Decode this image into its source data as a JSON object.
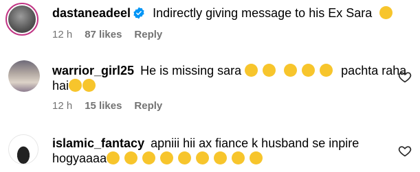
{
  "comments": [
    {
      "username": "dastaneadeel",
      "verified": true,
      "text": "Indirectly giving message to his Ex Sara",
      "time": "12 h",
      "likes": "87 likes",
      "reply": "Reply",
      "emoji_after": [
        "face-with-tears-of-joy-icon"
      ]
    },
    {
      "username": "warrior_girl25",
      "text_line1": "He is missing sara",
      "text_line1_after": "pachta raha",
      "text_line2": "hai",
      "time": "12 h",
      "likes": "15 likes",
      "reply": "Reply"
    },
    {
      "username": "islamic_fantacy",
      "text_line1": "apniii hii ax fiance k husband se inpire",
      "text_line2": "hogyaaaa"
    }
  ],
  "colors": {
    "meta": "#737373",
    "verified": "#0095f6",
    "emoji": "#f7c52c"
  }
}
